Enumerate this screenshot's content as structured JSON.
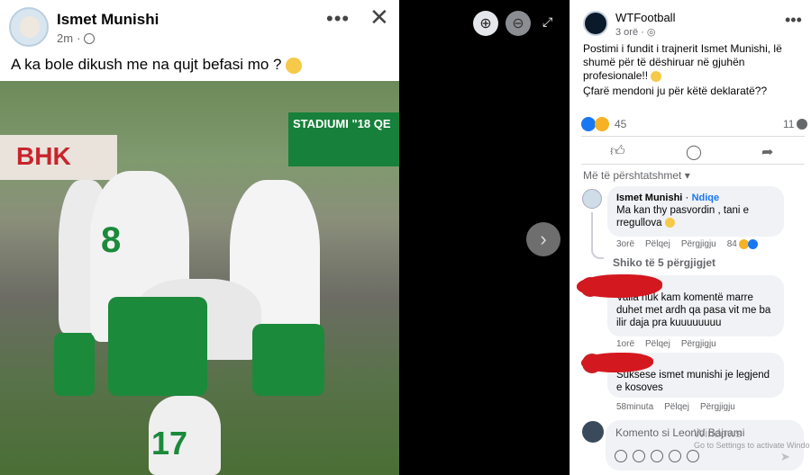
{
  "post": {
    "author": "Ismet Munishi",
    "time": "2m",
    "caption": "A ka bole dikush me na qujt befasi mo ?"
  },
  "photo": {
    "banner_left": "BHK",
    "banner_right": "STADIUMI \"18 QE",
    "jersey_numbers": [
      "8",
      "17"
    ]
  },
  "viewer": {
    "zoom_in_icon": "zoom-in-icon",
    "zoom_out_icon": "zoom-out-icon",
    "next_icon": "chevron-right-icon"
  },
  "page_post": {
    "page_name": "WTFootball",
    "time": "3 orë",
    "text": "Postimi i fundit i trajnerit Ismet Munishi, lë shumë për të dëshiruar në gjuhën profesionale!!",
    "question": "Çfarë mendoni ju për këtë deklaratë??",
    "reaction_count": "45",
    "comment_count": "11",
    "sort_label": "Më të përshtatshmet"
  },
  "comments": [
    {
      "author": "Ismet Munishi",
      "follow": "Ndiqe",
      "text": "Ma kan thy pasvordin , tani e rregullova",
      "time": "3orë",
      "like": "Pëlqej",
      "reply": "Përgjigju",
      "reactions": "84"
    },
    {
      "text": "Valla nuk kam komentë marre duhet met ardh qa pasa vit me ba ilir daja pra kuuuuuuuu",
      "time": "1orë",
      "like": "Pëlqej",
      "reply": "Përgjigju"
    },
    {
      "text": "Suksese ismet munishi je legjend e kosoves",
      "time": "58minuta",
      "like": "Pëlqej",
      "reply": "Përgjigju"
    }
  ],
  "replies_link": "Shiko të 5 përgjigjet",
  "composer": {
    "placeholder": "Komento si Leonid Bajrami"
  },
  "watermark": {
    "title": "Windows",
    "subtitle": "Go to Settings to activate Windo"
  }
}
